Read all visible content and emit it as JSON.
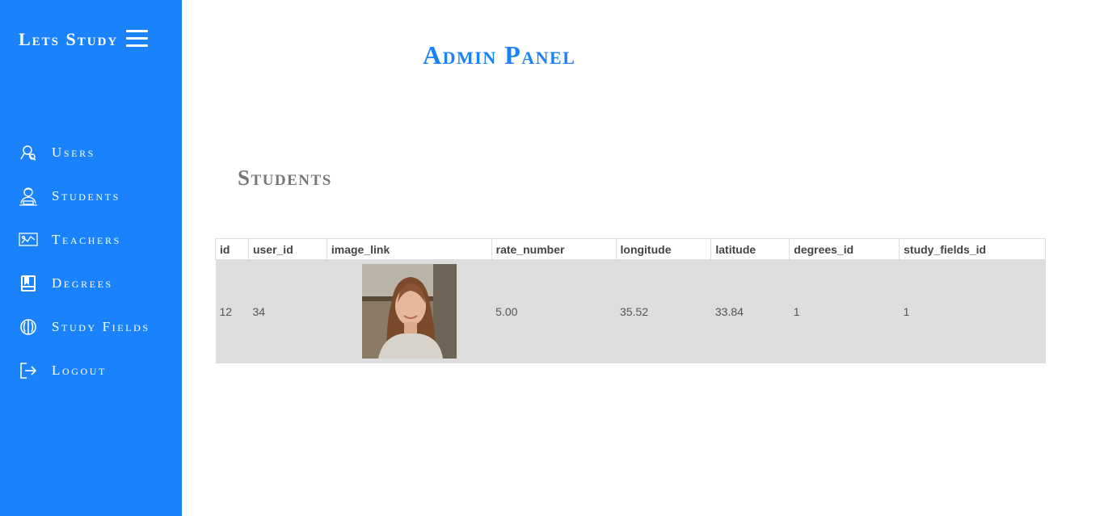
{
  "sidebar": {
    "brand": "Lets Study",
    "menu_icon": "hamburger-icon",
    "items": [
      {
        "label": "Users",
        "icon": "users-icon"
      },
      {
        "label": "Students",
        "icon": "student-icon"
      },
      {
        "label": "Teachers",
        "icon": "teacher-board-icon"
      },
      {
        "label": "Degrees",
        "icon": "book-icon"
      },
      {
        "label": "Study Fields",
        "icon": "brain-icon"
      },
      {
        "label": "Logout",
        "icon": "logout-icon"
      }
    ]
  },
  "main": {
    "title": "Admin Panel",
    "section_title": "Students",
    "table": {
      "headers": [
        "id",
        "user_id",
        "image_link",
        "rate_number",
        "longitude",
        "latitude",
        "degrees_id",
        "study_fields_id"
      ],
      "rows": [
        {
          "id": "12",
          "user_id": "34",
          "image_link": "student-photo",
          "rate_number": "5.00",
          "longitude": "35.52",
          "latitude": "33.84",
          "degrees_id": "1",
          "study_fields_id": "1"
        }
      ]
    }
  },
  "colors": {
    "accent": "#1a82fb",
    "sidebar_bg": "#1a82fb",
    "section_title": "#777777",
    "row_bg": "#dddddd"
  }
}
